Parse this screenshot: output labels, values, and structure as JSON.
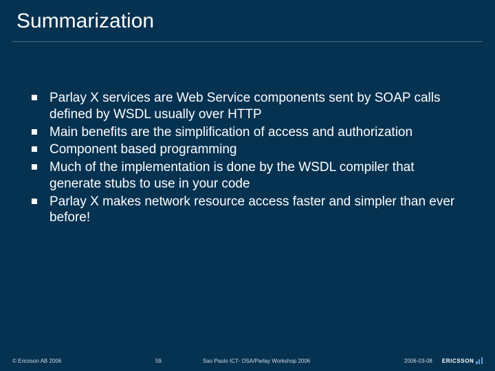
{
  "title": "Summarization",
  "bullets": [
    "Parlay X services are Web Service components sent by SOAP calls defined by WSDL usually over HTTP",
    "Main benefits are the simplification of access and authorization",
    "Component based programming",
    "Much of the implementation is done by the WSDL compiler that generate stubs to use in your code",
    "Parlay X makes network resource access faster and simpler than ever before!"
  ],
  "footer": {
    "copyright": "© Ericsson AB 2006",
    "page": "59",
    "event": "Sao Paulo ICT- OSA/Parlay Workshop 2006",
    "date": "2006-03-08",
    "logo_text": "ERICSSON"
  }
}
